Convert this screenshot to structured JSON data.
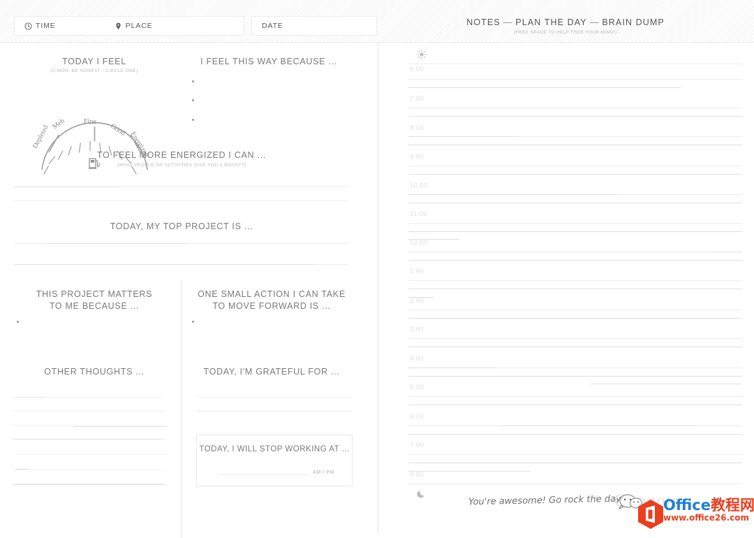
{
  "header": {
    "time_label": "TIME",
    "place_label": "PLACE",
    "date_label": "DATE",
    "time_value": "",
    "place_value": "",
    "date_value": "",
    "time_placeholder": "TIME",
    "place_placeholder": "PLACE",
    "date_placeholder": "DATE",
    "notes_title_part1": "NOTES",
    "notes_title_dash1": "—",
    "notes_title_part2": "PLAN THE DAY",
    "notes_title_dash2": "—",
    "notes_title_part3": "BRAIN DUMP",
    "notes_subtitle": "(FREE SPACE TO HELP FREE YOUR MIND!)"
  },
  "left": {
    "feel_title": "TODAY I FEEL",
    "feel_subtitle": "(C'MON, BE HONEST - CIRCLE ONE)",
    "gauge": {
      "labels": [
        "Depleted",
        "Meh",
        "Fine",
        "Good",
        "Energized"
      ],
      "icon": "fuel-pump-icon"
    },
    "because_title": "I FEEL THIS WAY BECAUSE ...",
    "energized_title": "TO FEEL MORE ENERGIZED I CAN ...",
    "energized_subtitle": "(WHAT PEOPLE OR ACTIVITIES GIVE YOU A BOOST?)",
    "top_project_title": "TODAY, MY TOP PROJECT IS ...",
    "matters_title_line1": "THIS PROJECT MATTERS",
    "matters_title_line2": "TO ME BECAUSE ...",
    "action_title_line1": "ONE SMALL ACTION I CAN TAKE",
    "action_title_line2": "TO MOVE FORWARD IS ...",
    "other_thoughts_title": "OTHER THOUGHTS ...",
    "grateful_title": "TODAY, I'M GRATEFUL FOR ...",
    "stop_working_title": "TODAY, I WILL STOP WORKING AT ...",
    "stop_working_ampm": "AM / PM"
  },
  "schedule": {
    "sun_icon": "sun-icon",
    "moon_icon": "moon-icon",
    "hours": [
      "6:00",
      "7:00",
      "8:00",
      "9:00",
      "10:00",
      "11:00",
      "12:00",
      "1:00",
      "2:00",
      "3:00",
      "4:00",
      "5:00",
      "6:00",
      "7:00",
      "8:00"
    ],
    "footer_note": "You're awesome! Go rock the day!"
  },
  "watermark": {
    "ghost_text": "Onenote",
    "brand": "Office",
    "brand_cn": "教程网",
    "url": "www.office26.com"
  },
  "colors": {
    "text": "#6e6e6e",
    "muted": "#b9b9b9",
    "rule": "#ececec",
    "brand_blue": "#1d7fd4",
    "brand_red": "#e8401f",
    "hour": "#dedede"
  }
}
